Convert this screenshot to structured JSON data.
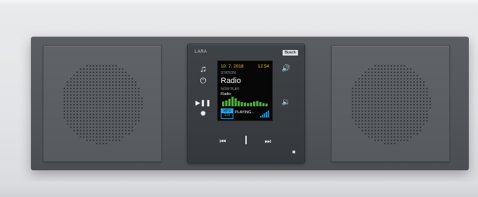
{
  "device": {
    "brand": "LARA",
    "logo": "Busch",
    "colors": {
      "date": "#e8c22c",
      "eq_bars": "#4fb23a",
      "signal": "#2aa0e0",
      "frame": "#53565b"
    }
  },
  "display": {
    "date": "10. 7. 2018",
    "time": "12:54",
    "station_label": "STATION:",
    "station": "Radio",
    "now_play_label": "NOW PLAY:",
    "now_play": "Radio",
    "format_top": "MP3",
    "format_bottom": "128",
    "status": "PLAYING..."
  },
  "controls": {
    "music": {
      "icon": "music-note-icon",
      "glyph": "♫"
    },
    "power": {
      "icon": "power-icon",
      "glyph": "⏻"
    },
    "play_pause": {
      "icon": "play-pause-icon",
      "glyph": "▶❚❚"
    },
    "settings": {
      "icon": "gear-icon",
      "glyph": "✹"
    },
    "volume_up": {
      "icon": "volume-up-icon",
      "glyph": "🔊"
    },
    "volume_down": {
      "icon": "volume-down-icon",
      "glyph": "🔉"
    },
    "previous": {
      "icon": "previous-icon",
      "glyph": "⏮"
    },
    "next": {
      "icon": "next-icon",
      "glyph": "⏭"
    }
  },
  "equalizer": {
    "levels": [
      0.45,
      0.55,
      0.7,
      0.9,
      0.75,
      0.5,
      0.4,
      0.35,
      0.3,
      0.35,
      0.45,
      0.5,
      0.4,
      0.3,
      0.25
    ]
  },
  "signal": {
    "bars": 5,
    "active": 5
  }
}
